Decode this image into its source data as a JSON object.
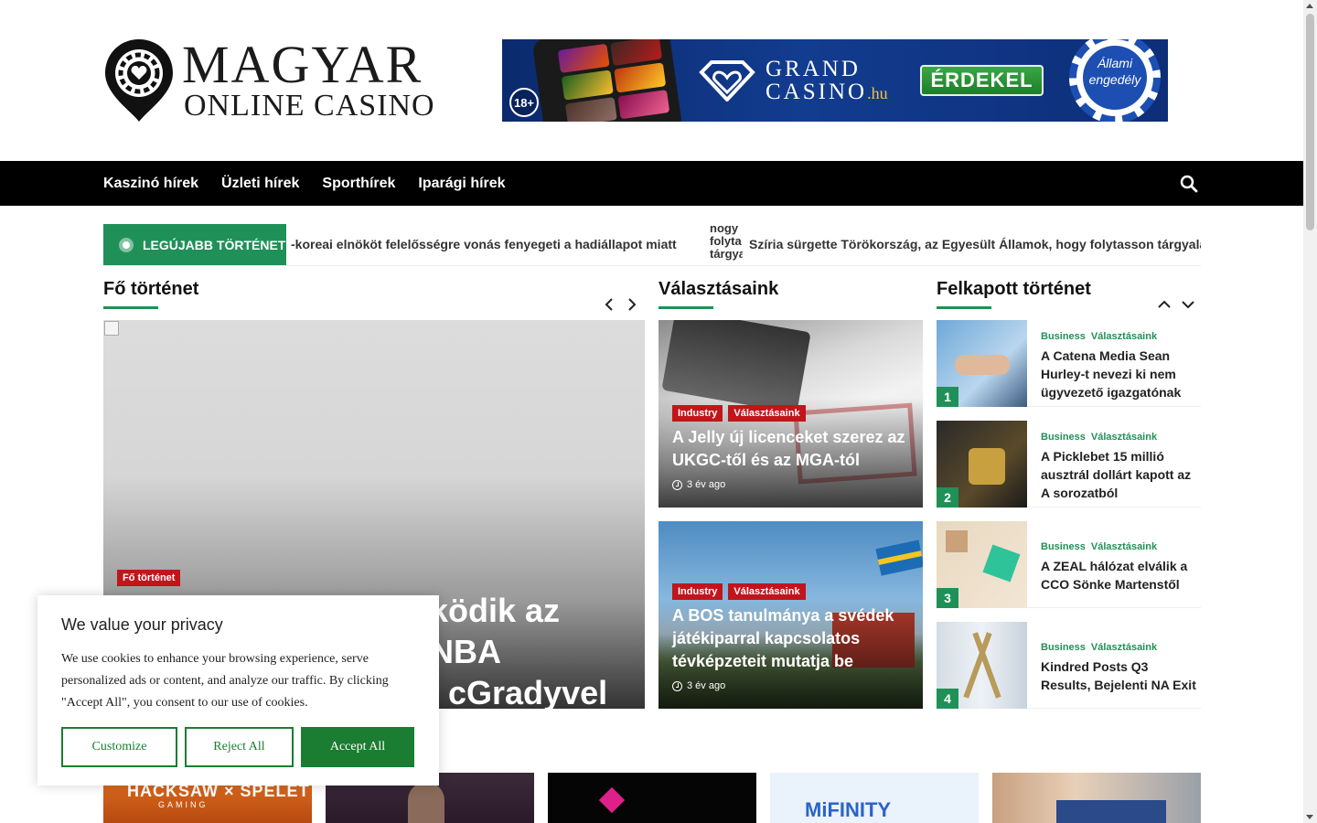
{
  "header": {
    "logo_line1": "MAGYAR",
    "logo_line2": "ONLINE CASINO",
    "banner": {
      "age": "18+",
      "brand_line1": "GRAND",
      "brand_line2": "CASINO",
      "brand_tld": ".hu",
      "cta": "ÉRDEKEL",
      "chip_text": "Állami engedély"
    }
  },
  "nav": {
    "items": [
      "Kaszinó hírek",
      "Üzleti hírek",
      "Sporthírek",
      "Iparági hírek"
    ],
    "search_icon": "search-icon"
  },
  "ticker": {
    "label": "LEGÚJABB TÖRTÉNET",
    "items": [
      "-koreai elnököt felelősségre vonás fenyegeti a hadiállapot miatt",
      "nogy folyta tárgya az",
      "Szíria sürgette Törökország, az Egyesült Államok, hogy folytasson tárgyalásokat"
    ]
  },
  "sections": {
    "main": "Fő történet",
    "choices": "Választásaink",
    "trending": "Felkapott történet"
  },
  "main_story": {
    "badge": "Fő történet",
    "title_line1": "ködik az NBA",
    "title_line2": "cGradyvel"
  },
  "choices": [
    {
      "badges": [
        "Industry",
        "Választásaink"
      ],
      "title": "A Jelly új licenceket szerez az UKGC-től és az MGA-tól",
      "time": "3 év ago"
    },
    {
      "badges": [
        "Industry",
        "Választásaink"
      ],
      "title": "A BOS tanulmánya a svédek játékiparral kapcsolatos tévképzeteit mutatja be",
      "time": "3 év ago"
    }
  ],
  "trending": [
    {
      "num": "1",
      "cats": [
        "Business",
        "Választásaink"
      ],
      "title": "A Catena Media Sean Hurley-t nevezi ki nem ügyvezető igazgatónak"
    },
    {
      "num": "2",
      "cats": [
        "Business",
        "Választásaink"
      ],
      "title": "A Picklebet 15 millió ausztrál dollárt kapott az A sorozatból"
    },
    {
      "num": "3",
      "cats": [
        "Business",
        "Választásaink"
      ],
      "title": "A ZEAL hálózat elválik a CCO Sönke Martenstől"
    },
    {
      "num": "4",
      "cats": [
        "Business",
        "Választásaink"
      ],
      "title": "Kindred Posts Q3 Results, Bejelenti NA Exit"
    }
  ],
  "bottom_thumbs": {
    "t1": "HACKSAW × SPELET",
    "t1_sub": "GAMING",
    "t4": "MiFINITY"
  },
  "cookie": {
    "title": "We value your privacy",
    "text": "We use cookies to enhance your browsing experience, serve personalized ads or content, and analyze our traffic. By clicking \"Accept All\", you consent to our use of cookies.",
    "customize": "Customize",
    "reject": "Reject All",
    "accept": "Accept All"
  },
  "colors": {
    "accent_green": "#1f9158",
    "badge_red": "#c0161b",
    "nav_bg": "#000000",
    "cookie_green": "#1a7d31"
  }
}
